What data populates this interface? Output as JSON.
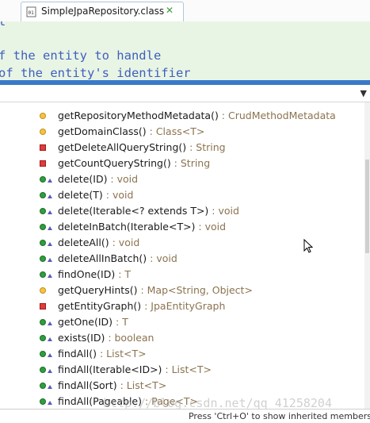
{
  "tab": {
    "title": "SimpleJpaRepository.class",
    "close": "✕"
  },
  "editor": {
    "lines": [
      "t",
      "f the entity to handle",
      "of the entity's identifier"
    ]
  },
  "outline": {
    "items": [
      {
        "name": "getRepositoryMethodMetadata()",
        "ret": " : CrudMethodMetadata",
        "icon": "protected-method-icon"
      },
      {
        "name": "getDomainClass()",
        "ret": " : Class<T>",
        "icon": "protected-method-icon"
      },
      {
        "name": "getDeleteAllQueryString()",
        "ret": " : String",
        "icon": "private-method-icon"
      },
      {
        "name": "getCountQueryString()",
        "ret": " : String",
        "icon": "private-method-icon"
      },
      {
        "name": "delete(ID)",
        "ret": " : void",
        "icon": "public-override-method-icon"
      },
      {
        "name": "delete(T)",
        "ret": " : void",
        "icon": "public-override-method-icon"
      },
      {
        "name": "delete(Iterable<? extends T>)",
        "ret": " : void",
        "icon": "public-override-method-icon"
      },
      {
        "name": "deleteInBatch(Iterable<T>)",
        "ret": " : void",
        "icon": "public-override-method-icon"
      },
      {
        "name": "deleteAll()",
        "ret": " : void",
        "icon": "public-override-method-icon"
      },
      {
        "name": "deleteAllInBatch()",
        "ret": " : void",
        "icon": "public-override-method-icon"
      },
      {
        "name": "findOne(ID)",
        "ret": " : T",
        "icon": "public-override-method-icon"
      },
      {
        "name": "getQueryHints()",
        "ret": " : Map<String, Object>",
        "icon": "protected-method-icon"
      },
      {
        "name": "getEntityGraph()",
        "ret": " : JpaEntityGraph",
        "icon": "private-method-icon"
      },
      {
        "name": "getOne(ID)",
        "ret": " : T",
        "icon": "public-override-method-icon"
      },
      {
        "name": "exists(ID)",
        "ret": " : boolean",
        "icon": "public-override-method-icon"
      },
      {
        "name": "findAll()",
        "ret": " : List<T>",
        "icon": "public-override-method-icon"
      },
      {
        "name": "findAll(Iterable<ID>)",
        "ret": " : List<T>",
        "icon": "public-override-method-icon"
      },
      {
        "name": "findAll(Sort)",
        "ret": " : List<T>",
        "icon": "public-override-method-icon"
      },
      {
        "name": "findAll(Pageable)",
        "ret": " : Page<T>",
        "icon": "public-override-method-icon"
      }
    ]
  },
  "status": {
    "text": "Press 'Ctrl+O' to show inherited members"
  },
  "watermark": "http://blog.csdn.net/qq_41258204",
  "colors": {
    "code": "#3f5fbf",
    "return_type": "#8b7350",
    "public": "#2e9e3e",
    "protected": "#f5c344",
    "private": "#e03c3c",
    "selection_bar": "#3a78c9",
    "editor_bg": "#e9f5e4"
  }
}
